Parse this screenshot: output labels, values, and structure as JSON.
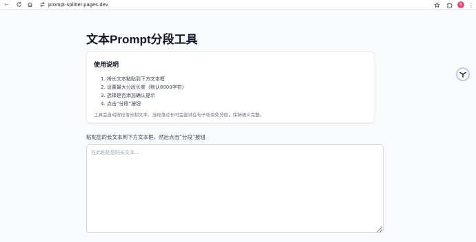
{
  "browser": {
    "url": "prompt-splitter.pages.dev",
    "profile_initial": "h",
    "icons": {
      "back": "arrow-left-icon",
      "reload": "reload-icon",
      "home": "home-icon",
      "site_info": "site-settings-icon",
      "bookmark": "star-icon",
      "extensions": "puzzle-icon",
      "menu": "more-vertical-icon"
    }
  },
  "page": {
    "title": "文本Prompt分段工具"
  },
  "instructions": {
    "title": "使用说明",
    "steps": [
      "1. 将长文本粘贴到下方文本框",
      "2. 设置最大分段长度（默认8000字符）",
      "3. 选择是否添加确认提示",
      "4. 点击“分段”按钮"
    ],
    "note": "工具会自动按段落分割文本，当段落过长时会尝试在句子结束处分段，保持语义完整。"
  },
  "input": {
    "label": "粘贴您的长文本到下方文本框，然后点击“分段”按钮",
    "placeholder": "在此粘贴您的长文本...",
    "value": ""
  },
  "colors": {
    "page_bg": "#f9fafb",
    "card_bg": "#ffffff",
    "title_text": "#111827",
    "muted_text": "#6b7280",
    "avatar_bg": "#e04b7a"
  }
}
